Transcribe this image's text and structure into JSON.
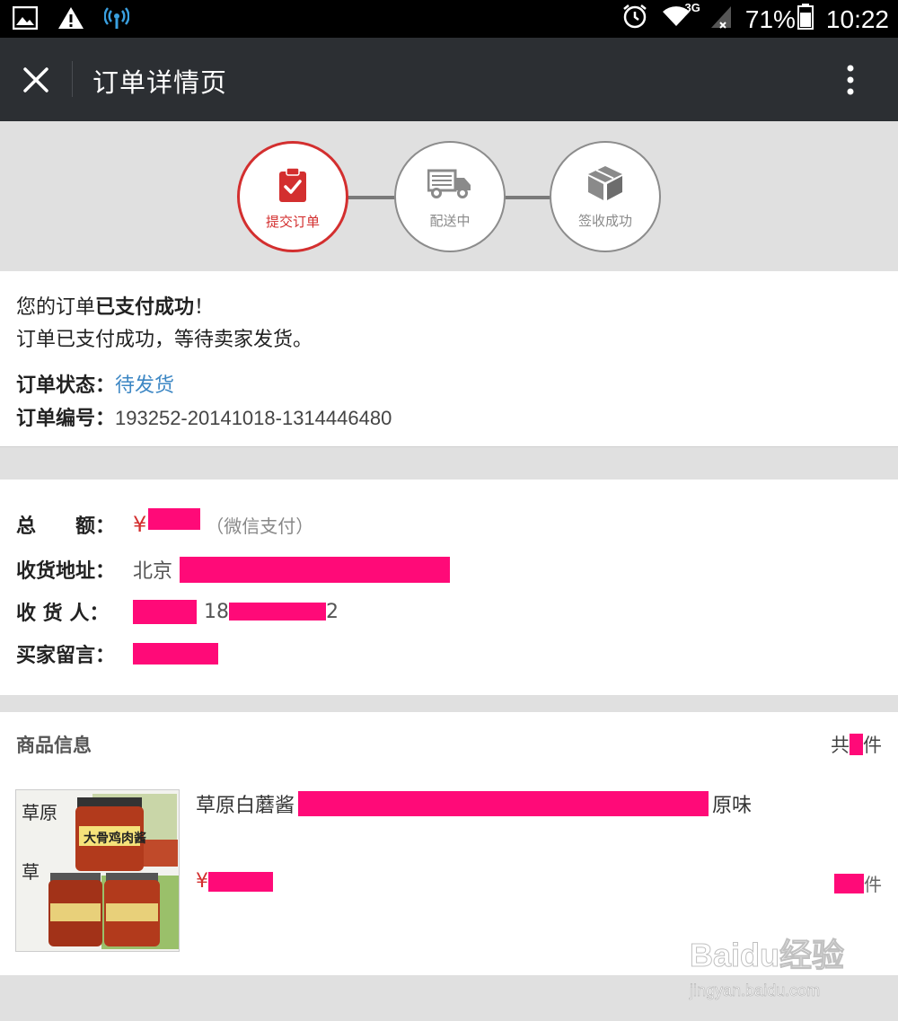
{
  "status_bar": {
    "battery": "71%",
    "time": "10:22",
    "network": "3G",
    "icons": [
      "image-icon",
      "warning-icon",
      "signal-broadcast-icon",
      "alarm-icon",
      "wifi-icon",
      "cell-signal-icon",
      "battery-icon"
    ]
  },
  "header": {
    "title": "订单详情页",
    "close_icon": "close-icon",
    "more_icon": "more-vertical-icon"
  },
  "steps": [
    {
      "label": "提交订单",
      "icon": "clipboard-check-icon",
      "active": true
    },
    {
      "label": "配送中",
      "icon": "truck-icon",
      "active": false
    },
    {
      "label": "签收成功",
      "icon": "box-icon",
      "active": false
    }
  ],
  "colors": {
    "accent": "#d32f2f",
    "link": "#3d87c4",
    "redaction": "#ff0a78",
    "header_bg": "#2c2f33"
  },
  "order_summary": {
    "msg_prefix": "您的订单",
    "msg_bold": "已支付成功",
    "msg_suffix": "！",
    "msg2": "订单已支付成功，等待卖家发货。",
    "status_label": "订单状态：",
    "status_value": "待发货",
    "orderno_label": "订单编号：",
    "orderno_value": "193252-20141018-1314446480"
  },
  "details": {
    "total_label": "总　　额：",
    "currency": "¥",
    "pay_method": "（微信支付）",
    "address_label": "收货地址：",
    "address_prefix": "北京",
    "receiver_label": "收 货 人：",
    "phone_prefix": "18",
    "phone_suffix": "2",
    "message_label": "买家留言："
  },
  "product": {
    "section_title": "商品信息",
    "count_prefix": "共",
    "count_suffix": "件",
    "name_prefix": "草原白蘑酱",
    "name_suffix": "原味",
    "currency": "¥",
    "qty_suffix": "件",
    "thumb_text": "大骨鸡肉酱"
  },
  "watermark": {
    "brand": "Baidu经验",
    "url": "jingyan.baidu.com"
  }
}
